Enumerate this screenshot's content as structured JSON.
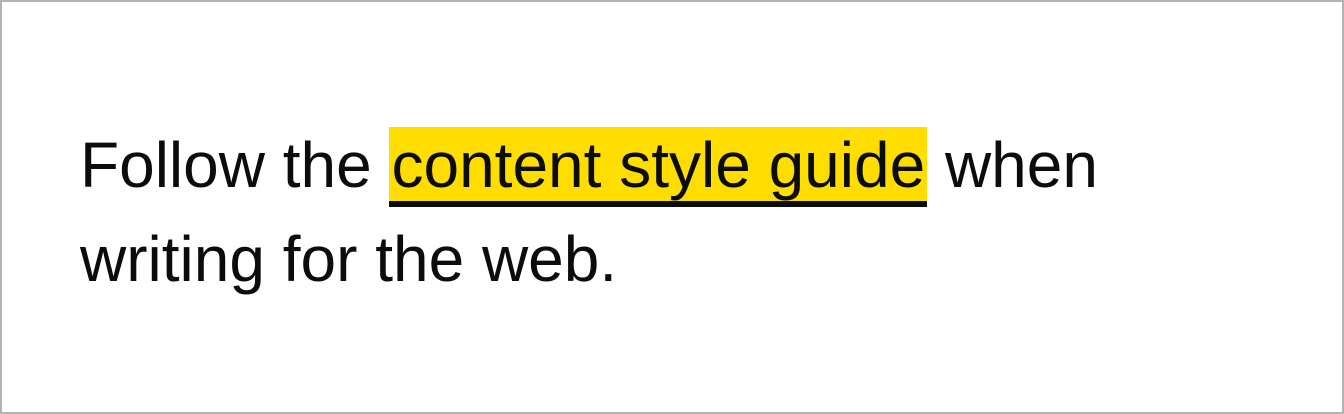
{
  "paragraph": {
    "before_link": "Follow the ",
    "link_text": "content style guide",
    "after_link": " when writing for the web."
  },
  "colors": {
    "focus_background": "#ffdd00",
    "text": "#0b0c0c",
    "border": "#b1b4b6"
  }
}
